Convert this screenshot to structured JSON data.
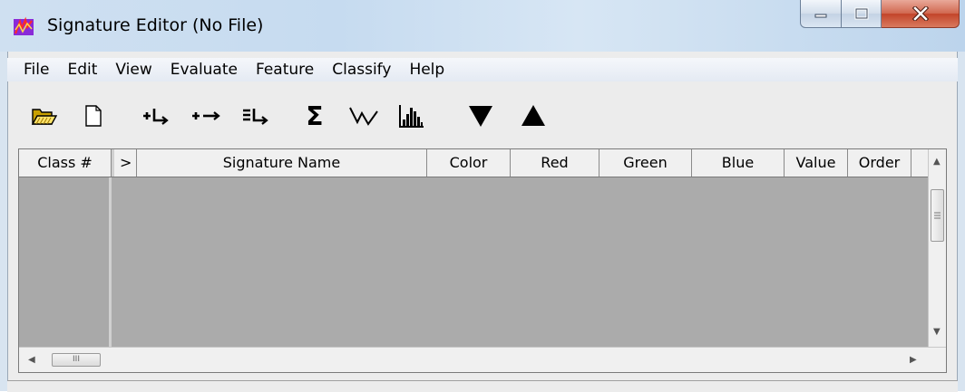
{
  "window": {
    "title": "Signature Editor (No File)",
    "icon": "signature-editor-app-icon",
    "controls": {
      "minimize": "minimize-icon",
      "maximize": "maximize-icon",
      "close": "close-icon"
    }
  },
  "menu": {
    "items": [
      "File",
      "Edit",
      "View",
      "Evaluate",
      "Feature",
      "Classify",
      "Help"
    ]
  },
  "toolbar": {
    "buttons": [
      {
        "name": "open-file",
        "icon": "folder-open-icon"
      },
      {
        "name": "new-file",
        "icon": "new-document-icon"
      },
      {
        "name": "add-signature",
        "icon": "add-row-icon",
        "glyph": "+L→"
      },
      {
        "name": "replace-signature",
        "icon": "replace-icon",
        "glyph": "+→"
      },
      {
        "name": "merge-signatures",
        "icon": "merge-icon",
        "glyph": "≡L→"
      },
      {
        "name": "statistics",
        "icon": "sigma-icon",
        "glyph": "Σ"
      },
      {
        "name": "mean-plot",
        "icon": "line-plot-icon"
      },
      {
        "name": "histogram",
        "icon": "histogram-icon"
      },
      {
        "name": "move-down",
        "icon": "triangle-down-icon",
        "glyph": "▼"
      },
      {
        "name": "move-up",
        "icon": "triangle-up-icon",
        "glyph": "▲"
      }
    ]
  },
  "grid": {
    "columns": [
      "Class #",
      ">",
      "Signature Name",
      "Color",
      "Red",
      "Green",
      "Blue",
      "Value",
      "Order"
    ],
    "rows": [],
    "hscroll_glyph": "III"
  },
  "colors": {
    "grid_background": "#ababab",
    "header_background": "#f0f0f0",
    "close_button": "#c8553d"
  }
}
